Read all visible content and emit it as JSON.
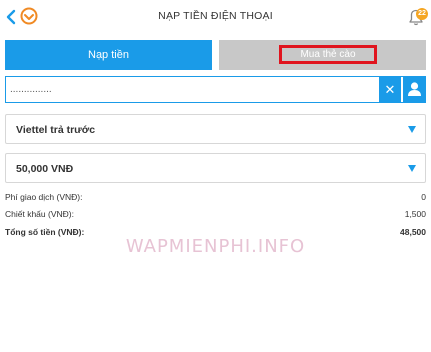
{
  "header": {
    "title": "NẠP TIỀN ĐIỆN THOẠI",
    "back_icon": "chevron-left-icon",
    "logo_icon": "app-logo",
    "bell_icon": "bell-icon",
    "notification_count": "22"
  },
  "tabs": {
    "topup_label": "Nạp tiền",
    "card_label": "Mua thẻ cào"
  },
  "phone": {
    "value": "...............",
    "clear_icon": "close-icon",
    "contact_icon": "contact-icon"
  },
  "provider": {
    "selected": "Viettel trả trước"
  },
  "amount": {
    "selected": "50,000 VNĐ"
  },
  "summary": {
    "fee_label": "Phí giao dịch (VNĐ):",
    "fee_value": "0",
    "discount_label": "Chiết khấu (VNĐ):",
    "discount_value": "1,500",
    "total_label": "Tổng số tiền (VNĐ):",
    "total_value": "48,500"
  },
  "watermark": "WAPMIENPHI.INFO",
  "colors": {
    "accent": "#1a9be8",
    "highlight_border": "#e0141e",
    "tab_inactive": "#c8c8c8",
    "badge": "#f5a623"
  }
}
